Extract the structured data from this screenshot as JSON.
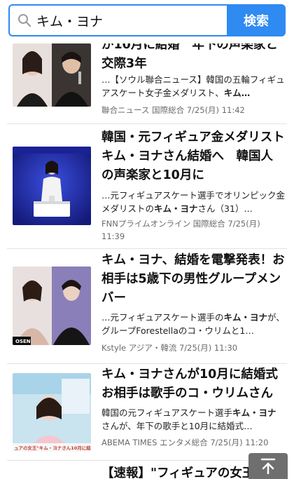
{
  "search": {
    "query": "キム・ヨナ",
    "button_label": "検索"
  },
  "articles": [
    {
      "title": "が10月に結婚　年下の声楽家と交際3年",
      "snippet_before": "…【ソウル聯合ニュース】韓国の五輪フィギュアスケート女子金メダリスト、",
      "snippet_bold": "キム…",
      "snippet_after": "",
      "source": "聯合ニュース",
      "category": "国際総合",
      "date": "7/25(月) 11:42"
    },
    {
      "title": "韓国・元フィギュア金メダリスト　キム・ヨナさん結婚へ　韓国人の声楽家と10月に",
      "snippet_before": "…元フィギュアスケート選手でオリンピック金メダリストの",
      "snippet_bold": "キム・ヨナ",
      "snippet_after": "さん（31）…",
      "source": "FNNプライムオンライン",
      "category": "国際総合",
      "date": "7/25(月) 11:39"
    },
    {
      "title": "キム・ヨナ、結婚を電撃発表！お相手は5歳下の男性グループメンバー",
      "snippet_before": "…元フィギュアスケート選手の",
      "snippet_bold": "キム・ヨナ",
      "snippet_after": "が、グループForestellaのコ・ウリムと1…",
      "source": "Kstyle",
      "category": "アジア・韓流",
      "date": "7/25(月) 11:30"
    },
    {
      "title": "キム・ヨナさんが10月に結婚式　お相手は歌手のコ・ウリムさん",
      "snippet_before": "韓国の元フィギュアスケート選手",
      "snippet_bold": "キム・ヨナ",
      "snippet_after": "さんが、年下の歌手と10月に結婚式…",
      "source": "ABEMA TIMES",
      "category": "エンタメ総合",
      "date": "7/25(月) 11:20"
    },
    {
      "title": "【速報】\"フィギュアの女王\"キ",
      "snippet_before": "",
      "snippet_bold": "",
      "snippet_after": "",
      "source": "",
      "category": "",
      "date": ""
    }
  ],
  "thumb_caption": "ュアの女王\"キム・ヨナさん10月に結婚",
  "thumb_watermark": "OSEN",
  "colors": {
    "accent": "#2f8af2",
    "meta_text": "#6b6b6b"
  },
  "icons": [
    "search-icon",
    "scroll-to-top-icon"
  ]
}
